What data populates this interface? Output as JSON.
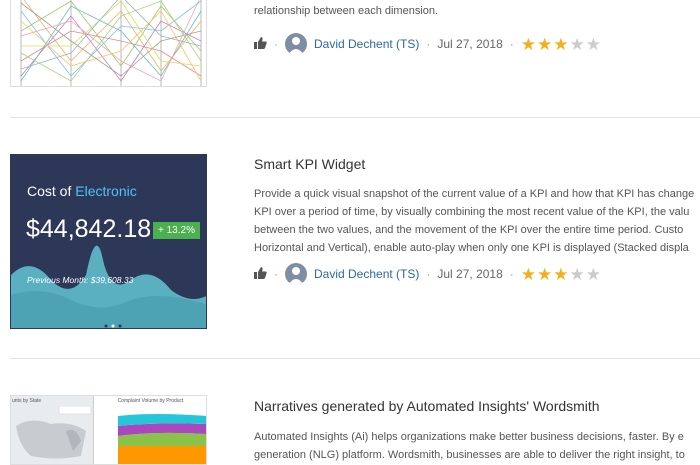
{
  "items": [
    {
      "title": "",
      "description_lines": [
        "relationship between each dimension."
      ],
      "author": "David Dechent (TS)",
      "date": "Jul 27, 2018",
      "rating": 3,
      "max_rating": 5
    },
    {
      "title": "Smart KPI Widget",
      "description_lines": [
        "Provide a quick visual snapshot of the current value of a KPI and how that KPI has change",
        "KPI over a period of time, by visually combining the most recent value of the KPI, the valu",
        "between the two values, and the movement of the KPI over the entire time period. Custo",
        "Horizontal and Vertical), enable auto-play when only one KPI is displayed (Stacked displa"
      ],
      "author": "David Dechent (TS)",
      "date": "Jul 27, 2018",
      "rating": 3,
      "max_rating": 5,
      "thumbnail": {
        "heading_prefix": "Cost of",
        "heading_highlight": "Electronic",
        "value": "$44,842.18",
        "change": "+ 13.2%",
        "previous": "Previous Month: $39,608.33"
      }
    },
    {
      "title": "Narratives generated by Automated Insights' Wordsmith",
      "description_lines": [
        "Automated Insights (Ai) helps organizations make better business decisions, faster. By e",
        "generation (NLG) platform. Wordsmith, businesses are able to deliver the right insight, to"
      ],
      "thumbnail": {
        "map_title": "unts by State",
        "chart_title": "Complaint Volume by Product"
      }
    }
  ],
  "colors": {
    "star_filled": "#f2b01e",
    "star_empty": "#cccccc",
    "author_link": "#2c6aa0",
    "kpi_bg": "#2d3757",
    "kpi_highlight": "#4fc3f7",
    "kpi_badge": "#4caf50",
    "kpi_wave": "#5ab0c0"
  },
  "icons": [
    "thumbs-up-icon",
    "avatar-icon",
    "star-icon"
  ]
}
